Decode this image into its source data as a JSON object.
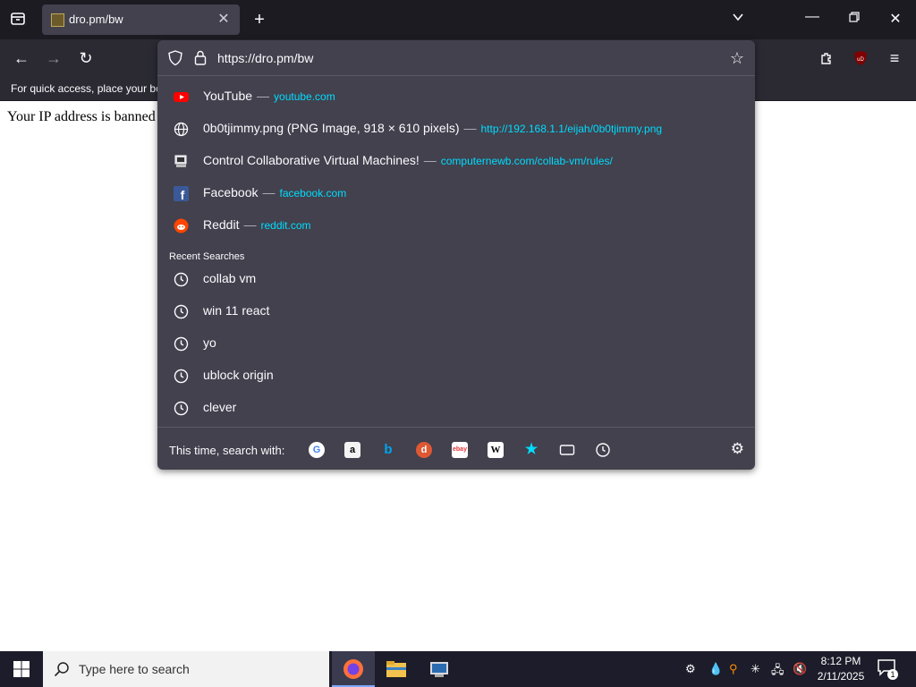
{
  "tab": {
    "title": "dro.pm/bw"
  },
  "urlbar": {
    "url": "https://dro.pm/bw"
  },
  "bookmarks_bar": {
    "hint": "For quick access, place your bo"
  },
  "page": {
    "text": "Your IP address is banned"
  },
  "suggestions": [
    {
      "title": "YouTube",
      "sep": "—",
      "url": "youtube.com",
      "icon": "youtube-icon"
    },
    {
      "title": "0b0tjimmy.png (PNG Image, 918 × 610 pixels)",
      "sep": "—",
      "url": "http://192.168.1.1/eijah/0b0tjimmy.png",
      "icon": "globe-icon"
    },
    {
      "title": "Control Collaborative Virtual Machines!",
      "sep": "—",
      "url": "computernewb.com/collab-vm/rules/",
      "icon": "collabvm-icon"
    },
    {
      "title": "Facebook",
      "sep": "—",
      "url": "facebook.com",
      "icon": "facebook-icon"
    },
    {
      "title": "Reddit",
      "sep": "—",
      "url": "reddit.com",
      "icon": "reddit-icon"
    }
  ],
  "recent_searches": {
    "heading": "Recent Searches",
    "items": [
      "collab vm",
      "win 11 react",
      "yo",
      "ublock origin",
      "clever"
    ]
  },
  "search_with": {
    "label": "This time, search with:",
    "engines": [
      "google-icon",
      "amazon-icon",
      "bing-icon",
      "duckduckgo-icon",
      "ebay-icon",
      "wikipedia-icon",
      "bookmarks-star-icon",
      "tabs-icon",
      "history-icon"
    ]
  },
  "taskbar": {
    "search_placeholder": "Type here to search",
    "time": "8:12 PM",
    "date": "2/11/2025",
    "notification_count": "1"
  },
  "colors": {
    "accent_link": "#00ddff",
    "panel": "#42414d",
    "toolbar": "#2b2a33"
  }
}
